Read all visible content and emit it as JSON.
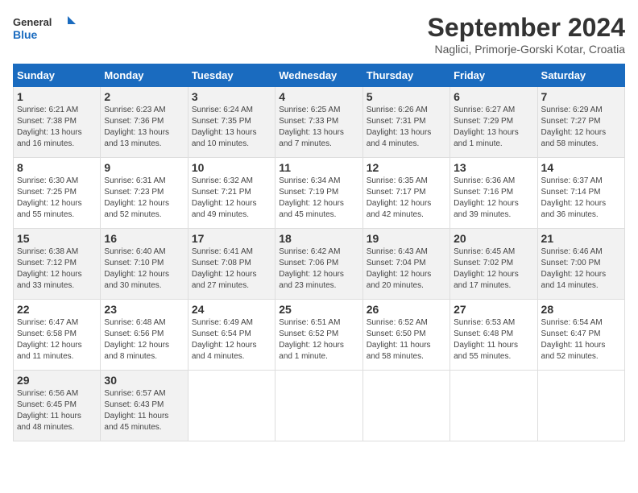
{
  "header": {
    "logo_line1": "General",
    "logo_line2": "Blue",
    "month": "September 2024",
    "location": "Naglici, Primorje-Gorski Kotar, Croatia"
  },
  "weekdays": [
    "Sunday",
    "Monday",
    "Tuesday",
    "Wednesday",
    "Thursday",
    "Friday",
    "Saturday"
  ],
  "weeks": [
    [
      {
        "day": "1",
        "text": "Sunrise: 6:21 AM\nSunset: 7:38 PM\nDaylight: 13 hours\nand 16 minutes."
      },
      {
        "day": "2",
        "text": "Sunrise: 6:23 AM\nSunset: 7:36 PM\nDaylight: 13 hours\nand 13 minutes."
      },
      {
        "day": "3",
        "text": "Sunrise: 6:24 AM\nSunset: 7:35 PM\nDaylight: 13 hours\nand 10 minutes."
      },
      {
        "day": "4",
        "text": "Sunrise: 6:25 AM\nSunset: 7:33 PM\nDaylight: 13 hours\nand 7 minutes."
      },
      {
        "day": "5",
        "text": "Sunrise: 6:26 AM\nSunset: 7:31 PM\nDaylight: 13 hours\nand 4 minutes."
      },
      {
        "day": "6",
        "text": "Sunrise: 6:27 AM\nSunset: 7:29 PM\nDaylight: 13 hours\nand 1 minute."
      },
      {
        "day": "7",
        "text": "Sunrise: 6:29 AM\nSunset: 7:27 PM\nDaylight: 12 hours\nand 58 minutes."
      }
    ],
    [
      {
        "day": "8",
        "text": "Sunrise: 6:30 AM\nSunset: 7:25 PM\nDaylight: 12 hours\nand 55 minutes."
      },
      {
        "day": "9",
        "text": "Sunrise: 6:31 AM\nSunset: 7:23 PM\nDaylight: 12 hours\nand 52 minutes."
      },
      {
        "day": "10",
        "text": "Sunrise: 6:32 AM\nSunset: 7:21 PM\nDaylight: 12 hours\nand 49 minutes."
      },
      {
        "day": "11",
        "text": "Sunrise: 6:34 AM\nSunset: 7:19 PM\nDaylight: 12 hours\nand 45 minutes."
      },
      {
        "day": "12",
        "text": "Sunrise: 6:35 AM\nSunset: 7:17 PM\nDaylight: 12 hours\nand 42 minutes."
      },
      {
        "day": "13",
        "text": "Sunrise: 6:36 AM\nSunset: 7:16 PM\nDaylight: 12 hours\nand 39 minutes."
      },
      {
        "day": "14",
        "text": "Sunrise: 6:37 AM\nSunset: 7:14 PM\nDaylight: 12 hours\nand 36 minutes."
      }
    ],
    [
      {
        "day": "15",
        "text": "Sunrise: 6:38 AM\nSunset: 7:12 PM\nDaylight: 12 hours\nand 33 minutes."
      },
      {
        "day": "16",
        "text": "Sunrise: 6:40 AM\nSunset: 7:10 PM\nDaylight: 12 hours\nand 30 minutes."
      },
      {
        "day": "17",
        "text": "Sunrise: 6:41 AM\nSunset: 7:08 PM\nDaylight: 12 hours\nand 27 minutes."
      },
      {
        "day": "18",
        "text": "Sunrise: 6:42 AM\nSunset: 7:06 PM\nDaylight: 12 hours\nand 23 minutes."
      },
      {
        "day": "19",
        "text": "Sunrise: 6:43 AM\nSunset: 7:04 PM\nDaylight: 12 hours\nand 20 minutes."
      },
      {
        "day": "20",
        "text": "Sunrise: 6:45 AM\nSunset: 7:02 PM\nDaylight: 12 hours\nand 17 minutes."
      },
      {
        "day": "21",
        "text": "Sunrise: 6:46 AM\nSunset: 7:00 PM\nDaylight: 12 hours\nand 14 minutes."
      }
    ],
    [
      {
        "day": "22",
        "text": "Sunrise: 6:47 AM\nSunset: 6:58 PM\nDaylight: 12 hours\nand 11 minutes."
      },
      {
        "day": "23",
        "text": "Sunrise: 6:48 AM\nSunset: 6:56 PM\nDaylight: 12 hours\nand 8 minutes."
      },
      {
        "day": "24",
        "text": "Sunrise: 6:49 AM\nSunset: 6:54 PM\nDaylight: 12 hours\nand 4 minutes."
      },
      {
        "day": "25",
        "text": "Sunrise: 6:51 AM\nSunset: 6:52 PM\nDaylight: 12 hours\nand 1 minute."
      },
      {
        "day": "26",
        "text": "Sunrise: 6:52 AM\nSunset: 6:50 PM\nDaylight: 11 hours\nand 58 minutes."
      },
      {
        "day": "27",
        "text": "Sunrise: 6:53 AM\nSunset: 6:48 PM\nDaylight: 11 hours\nand 55 minutes."
      },
      {
        "day": "28",
        "text": "Sunrise: 6:54 AM\nSunset: 6:47 PM\nDaylight: 11 hours\nand 52 minutes."
      }
    ],
    [
      {
        "day": "29",
        "text": "Sunrise: 6:56 AM\nSunset: 6:45 PM\nDaylight: 11 hours\nand 48 minutes."
      },
      {
        "day": "30",
        "text": "Sunrise: 6:57 AM\nSunset: 6:43 PM\nDaylight: 11 hours\nand 45 minutes."
      },
      {
        "day": "",
        "text": ""
      },
      {
        "day": "",
        "text": ""
      },
      {
        "day": "",
        "text": ""
      },
      {
        "day": "",
        "text": ""
      },
      {
        "day": "",
        "text": ""
      }
    ]
  ]
}
